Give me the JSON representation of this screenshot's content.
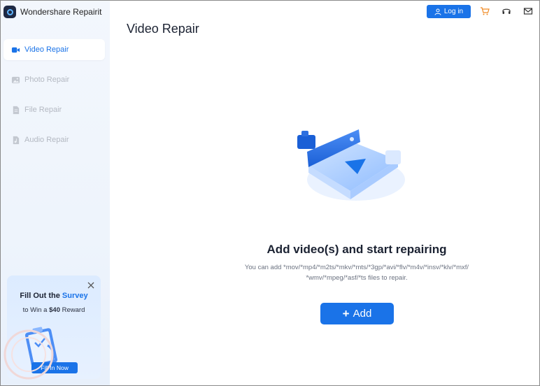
{
  "app": {
    "title": "Wondershare Repairit"
  },
  "sidebar": {
    "items": [
      {
        "label": "Video Repair",
        "icon": "video-icon",
        "active": true
      },
      {
        "label": "Photo Repair",
        "icon": "photo-icon",
        "active": false
      },
      {
        "label": "File Repair",
        "icon": "file-icon",
        "active": false
      },
      {
        "label": "Audio Repair",
        "icon": "audio-icon",
        "active": false
      }
    ]
  },
  "survey": {
    "title_prefix": "Fill Out the ",
    "title_highlight": "Survey",
    "subtitle_prefix": "to Win a ",
    "subtitle_amount": "$40",
    "subtitle_suffix": " Reward",
    "button_label": "Fill In Now"
  },
  "header": {
    "login_label": "Log in",
    "icons": [
      "cart-icon",
      "headset-icon",
      "mail-icon"
    ]
  },
  "main": {
    "title": "Video Repair",
    "headline": "Add video(s) and start repairing",
    "formats_line1": "You can add *mov/*mp4/*m2ts/*mkv/*mts/*3gp/*avi/*flv/*m4v/*insv/*klv/*mxf/",
    "formats_line2": "*wmv/*mpeg/*asf/*ts files to repair.",
    "add_label": "Add"
  },
  "colors": {
    "accent": "#1a73e8",
    "cart": "#f08a24",
    "text": "#1b2232",
    "muted": "#6b7280"
  }
}
